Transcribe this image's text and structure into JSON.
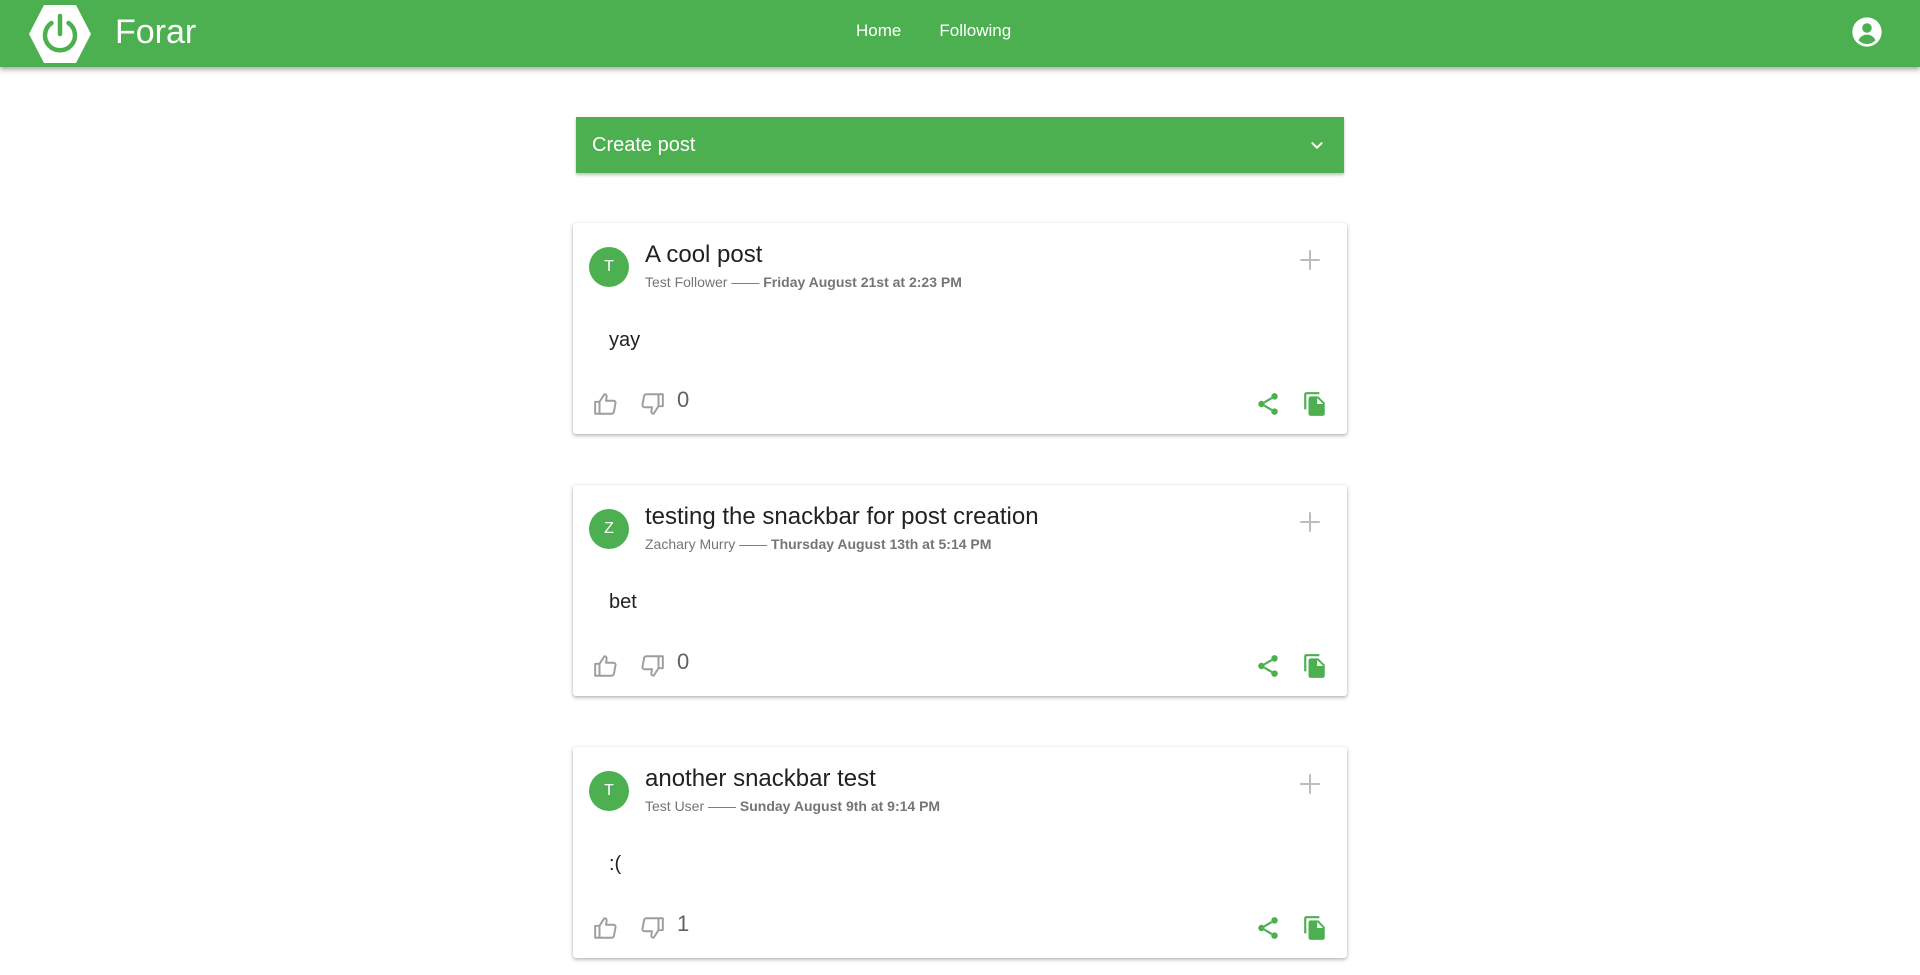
{
  "app": {
    "name": "Forar",
    "nav": [
      {
        "label": "Home"
      },
      {
        "label": "Following"
      }
    ]
  },
  "colors": {
    "primary": "#4caf50",
    "icon_inactive": "#9e9e9e"
  },
  "create_post": {
    "label": "Create post"
  },
  "posts": [
    {
      "avatar": "T",
      "title": "A cool post",
      "author": "Test Follower",
      "separator": "——",
      "date": "Friday August 21st at 2:23 PM",
      "body": "yay",
      "score": "0"
    },
    {
      "avatar": "Z",
      "title": "testing the snackbar for post creation",
      "author": "Zachary Murry",
      "separator": "——",
      "date": "Thursday August 13th at 5:14 PM",
      "body": "bet",
      "score": "0"
    },
    {
      "avatar": "T",
      "title": "another snackbar test",
      "author": "Test User",
      "separator": "——",
      "date": "Sunday August 9th at 9:14 PM",
      "body": ":(",
      "score": "1"
    }
  ]
}
